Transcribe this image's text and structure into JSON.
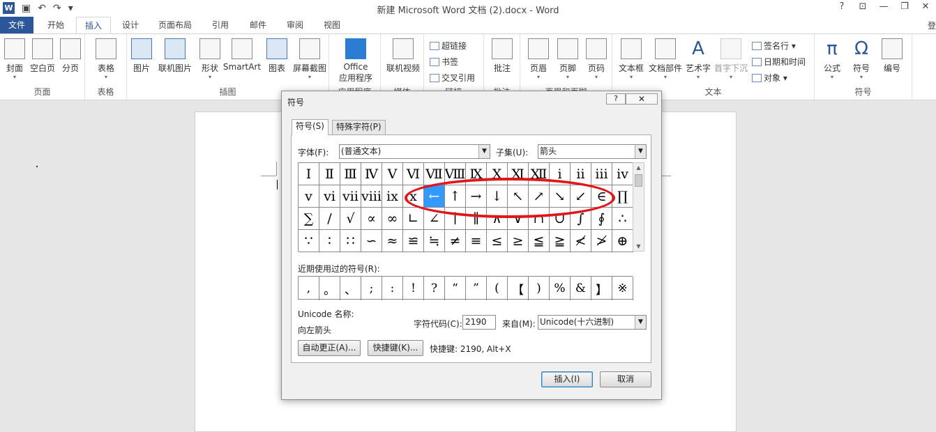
{
  "titlebar": {
    "title": "新建 Microsoft Word 文档 (2).docx - Word",
    "word_logo": "W",
    "undo_icon": "↶",
    "redo_icon": "↷",
    "customize_icon": "▾",
    "help": "?",
    "ribbon_options": "⊡",
    "minimize": "—",
    "restore": "❐",
    "close": "✕"
  },
  "tabs": [
    "文件",
    "开始",
    "插入",
    "设计",
    "页面布局",
    "引用",
    "邮件",
    "审阅",
    "视图"
  ],
  "active_tab": "插入",
  "user_signin": "登",
  "ribbon": {
    "groups": [
      {
        "label": "页面",
        "buttons": [
          "封面",
          "空白页",
          "分页"
        ]
      },
      {
        "label": "表格",
        "buttons": [
          "表格"
        ]
      },
      {
        "label": "插图",
        "buttons": [
          "图片",
          "联机图片",
          "形状",
          "SmartArt",
          "图表",
          "屏幕截图"
        ]
      },
      {
        "label": "应用程序",
        "buttons": [
          "Office",
          "应用程序"
        ]
      },
      {
        "label": "媒体",
        "buttons": [
          "联机视频"
        ]
      },
      {
        "label": "链接",
        "buttons": [
          "超链接",
          "书签",
          "交叉引用"
        ]
      },
      {
        "label": "批注",
        "buttons": [
          "批注"
        ]
      },
      {
        "label": "页眉和页脚",
        "buttons": [
          "页眉",
          "页脚",
          "页码"
        ]
      },
      {
        "label": "文本",
        "buttons": [
          "文本框",
          "文档部件",
          "艺术字",
          "首字下沉",
          "签名行",
          "日期和时间",
          "对象"
        ]
      },
      {
        "label": "符号",
        "buttons": [
          "公式",
          "符号",
          "编号"
        ]
      }
    ]
  },
  "dialog": {
    "title": "符号",
    "help": "?",
    "close": "✕",
    "tab_symbols": "符号(S)",
    "tab_special": "特殊字符(P)",
    "font_label": "字体(F):",
    "font_value": "(普通文本)",
    "subset_label": "子集(U):",
    "subset_value": "箭头",
    "symbols": [
      "Ⅰ",
      "Ⅱ",
      "Ⅲ",
      "Ⅳ",
      "Ⅴ",
      "Ⅵ",
      "Ⅶ",
      "Ⅷ",
      "Ⅸ",
      "Ⅹ",
      "Ⅺ",
      "Ⅻ",
      "ⅰ",
      "ⅱ",
      "ⅲ",
      "ⅳ",
      "ⅴ",
      "ⅵ",
      "ⅶ",
      "ⅷ",
      "ⅸ",
      "ⅹ",
      "←",
      "↑",
      "→",
      "↓",
      "↖",
      "↗",
      "↘",
      "↙",
      "∈",
      "∏",
      "∑",
      "∕",
      "√",
      "∝",
      "∞",
      "∟",
      "∠",
      "∣",
      "∥",
      "∧",
      "∨",
      "∩",
      "∪",
      "∫",
      "∮",
      "∴",
      "∵",
      "∶",
      "∷",
      "∽",
      "≈",
      "≌",
      "≒",
      "≠",
      "≡",
      "≤",
      "≥",
      "≦",
      "≧",
      "≮",
      "≯",
      "⊕"
    ],
    "selected_index": 22,
    "recent_label": "近期使用过的符号(R):",
    "recent": [
      ",",
      "。",
      "、",
      ";",
      ":",
      "!",
      "?",
      "“",
      "”",
      "(",
      "【",
      ")",
      "%",
      "&",
      "】",
      "※"
    ],
    "unicode_name_label": "Unicode 名称:",
    "unicode_name": "向左箭头",
    "charcode_label": "字符代码(C):",
    "charcode_value": "2190",
    "from_label": "来自(M):",
    "from_value": "Unicode(十六进制)",
    "autocorrect_btn": "自动更正(A)...",
    "shortcut_btn": "快捷键(K)...",
    "shortcut_text": "快捷键: 2190, Alt+X",
    "insert_btn": "插入(I)",
    "cancel_btn": "取消"
  },
  "colors": {
    "accent": "#2b579a",
    "selection": "#3399ff",
    "annotation": "#e0161b"
  }
}
